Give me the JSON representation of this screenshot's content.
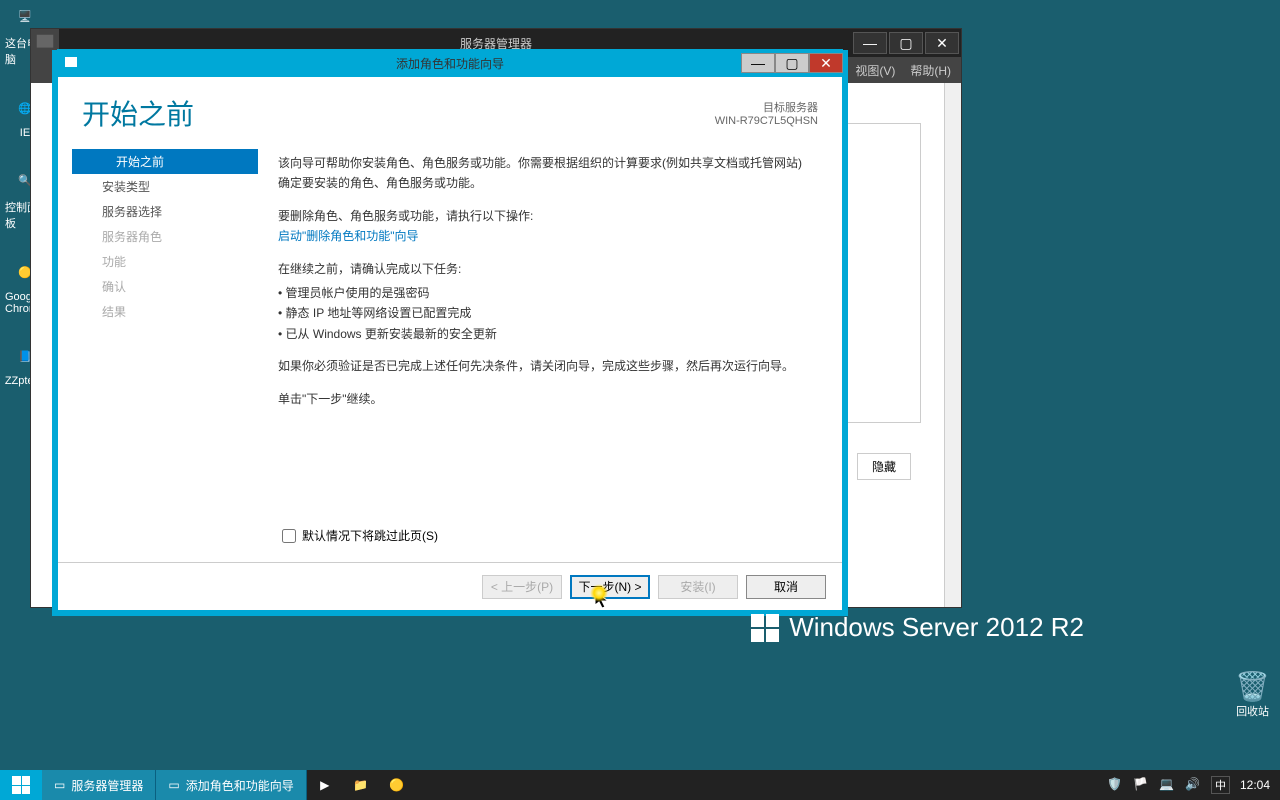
{
  "desktop": {
    "icons_left": [
      "这台电脑",
      "IE",
      "控制面板",
      "Google Chrome",
      "ZZptech"
    ],
    "recycle": "回收站"
  },
  "serverManager": {
    "title": "服务器管理器",
    "menus": {
      "view": "视图(V)",
      "help": "帮助(H)"
    },
    "hide": "隐藏"
  },
  "wizard": {
    "title": "添加角色和功能向导",
    "header": "开始之前",
    "target_label": "目标服务器",
    "target_name": "WIN-R79C7L5QHSN",
    "nav": [
      {
        "label": "开始之前",
        "state": "active"
      },
      {
        "label": "安装类型",
        "state": ""
      },
      {
        "label": "服务器选择",
        "state": ""
      },
      {
        "label": "服务器角色",
        "state": "disabled"
      },
      {
        "label": "功能",
        "state": "disabled"
      },
      {
        "label": "确认",
        "state": "disabled"
      },
      {
        "label": "结果",
        "state": "disabled"
      }
    ],
    "para1": "该向导可帮助你安装角色、角色服务或功能。你需要根据组织的计算要求(例如共享文档或托管网站)确定要安装的角色、角色服务或功能。",
    "para2": "要删除角色、角色服务或功能，请执行以下操作:",
    "link": "启动\"删除角色和功能\"向导",
    "para3": "在继续之前，请确认完成以下任务:",
    "bullets": [
      "• 管理员帐户使用的是强密码",
      "• 静态 IP 地址等网络设置已配置完成",
      "• 已从 Windows 更新安装最新的安全更新"
    ],
    "para4": "如果你必须验证是否已完成上述任何先决条件，请关闭向导，完成这些步骤，然后再次运行向导。",
    "para5": "单击\"下一步\"继续。",
    "skip": "默认情况下将跳过此页(S)",
    "btn_prev": "< 上一步(P)",
    "btn_next": "下一步(N) >",
    "btn_install": "安装(I)",
    "btn_cancel": "取消"
  },
  "watermark": "Windows Server 2012 R2",
  "taskbar": {
    "items": [
      "服务器管理器",
      "添加角色和功能向导"
    ],
    "clock": "12:04",
    "ime": "中"
  }
}
